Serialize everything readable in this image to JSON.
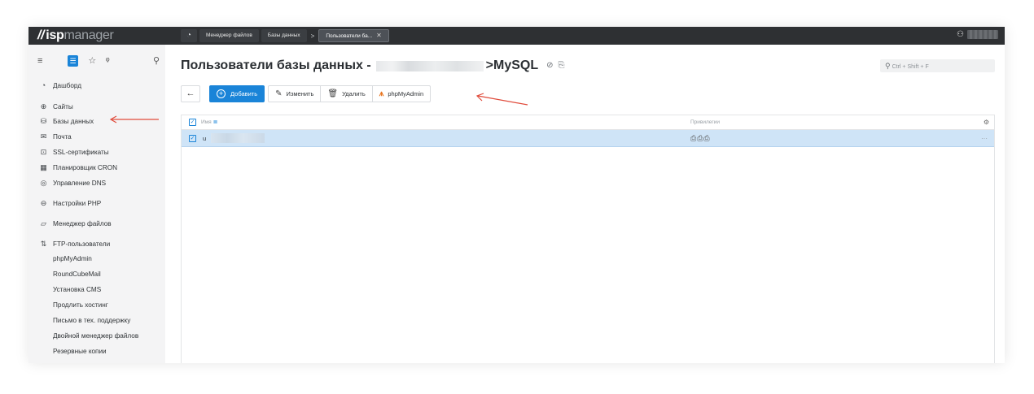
{
  "topbar": {
    "logo_slash": "//",
    "logo_isp": "isp",
    "logo_manager": "manager",
    "home_icon": "dashboard-icon",
    "tabs": [
      {
        "label": "Менеджер файлов"
      },
      {
        "label": "Базы данных"
      },
      {
        "label": "Пользователи ба..."
      }
    ],
    "tab_separator": ">",
    "close_glyph": "✕",
    "user_icon": "user-icon"
  },
  "sidebar": {
    "tools": [
      "menu-icon",
      "list-icon",
      "star-icon",
      "favorites-icon",
      "search-icon"
    ],
    "items": [
      {
        "label": "Дашборд",
        "icon": "dashboard-icon"
      },
      {
        "label": "Сайты",
        "icon": "globe-icon"
      },
      {
        "label": "Базы данных",
        "icon": "database-icon"
      },
      {
        "label": "Почта",
        "icon": "mail-icon"
      },
      {
        "label": "SSL-сертификаты",
        "icon": "lock-icon"
      },
      {
        "label": "Планировщик CRON",
        "icon": "calendar-icon"
      },
      {
        "label": "Управление DNS",
        "icon": "dns-icon"
      },
      {
        "label": "Настройки PHP",
        "icon": "php-icon"
      },
      {
        "label": "Менеджер файлов",
        "icon": "folder-icon"
      },
      {
        "label": "FTP-пользователи",
        "icon": "ftp-icon"
      }
    ],
    "links": [
      "phpMyAdmin",
      "RoundCubeMail",
      "Установка CMS",
      "Продлить хостинг",
      "Письмо в тех. поддержку",
      "Двойной менеджер файлов",
      "Резервные копии"
    ]
  },
  "main": {
    "title_prefix": "Пользователи базы данных -",
    "title_suffix": ">MySQL",
    "search_placeholder": "Ctrl + Shift + F",
    "toolbar": {
      "back_glyph": "←",
      "add_label": "Добавить",
      "edit_label": "Изменить",
      "delete_label": "Удалить",
      "pma_label": "phpMyAdmin"
    },
    "table": {
      "columns": [
        "Имя",
        "Привилегии"
      ],
      "rows": [
        {
          "name_visible": "u"
        }
      ]
    }
  },
  "colors": {
    "accent": "#1a84d8",
    "topbar": "#2e3033",
    "row_selected": "#cfe4f7",
    "annotation_arrow": "#e04a3a"
  }
}
